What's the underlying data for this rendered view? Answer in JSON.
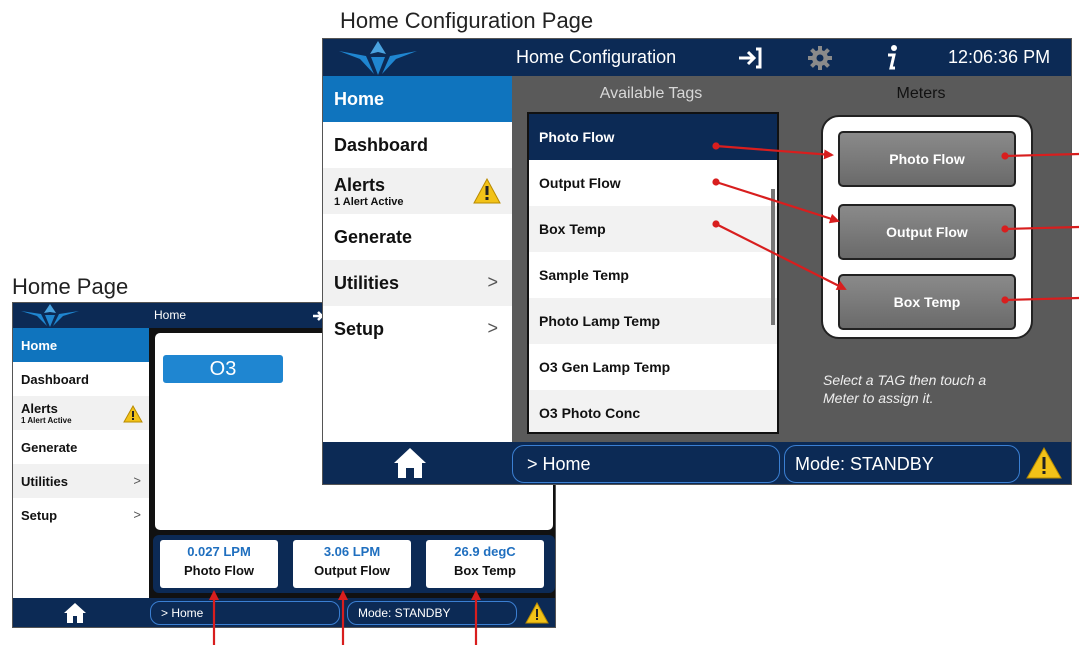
{
  "captions": {
    "home_config": "Home Configuration Page",
    "home": "Home Page"
  },
  "colors": {
    "navy": "#0c2a55",
    "selected_blue": "#0f74be",
    "value_blue": "#1f6fbf",
    "warning_yellow": "#f2c218",
    "arrow_red": "#d81e1e"
  },
  "home_page": {
    "title": "Home",
    "sidebar": [
      {
        "label": "Home",
        "selected": true
      },
      {
        "label": "Dashboard"
      },
      {
        "label": "Alerts",
        "sub": "1 Alert Active",
        "icon": "warning-icon"
      },
      {
        "label": "Generate"
      },
      {
        "label": "Utilities",
        "chevron": ">"
      },
      {
        "label": "Setup",
        "chevron": ">"
      }
    ],
    "o3_label": "O3",
    "meters": [
      {
        "value": "0.027 LPM",
        "label": "Photo Flow"
      },
      {
        "value": "3.06 LPM",
        "label": "Output Flow"
      },
      {
        "value": "26.9 degC",
        "label": "Box Temp"
      }
    ],
    "breadcrumb": "> Home",
    "mode": "Mode: STANDBY"
  },
  "home_config_page": {
    "title": "Home Configuration",
    "time": "12:06:36 PM",
    "sidebar": [
      {
        "label": "Home",
        "selected": true
      },
      {
        "label": "Dashboard"
      },
      {
        "label": "Alerts",
        "sub": "1 Alert Active",
        "icon": "warning-icon"
      },
      {
        "label": "Generate"
      },
      {
        "label": "Utilities",
        "chevron": ">"
      },
      {
        "label": "Setup",
        "chevron": ">"
      }
    ],
    "available_tags_header": "Available Tags",
    "meters_header": "Meters",
    "tags": [
      "Photo Flow",
      "Output Flow",
      "Box Temp",
      "Sample Temp",
      "Photo Lamp Temp",
      "O3 Gen Lamp Temp",
      "O3 Photo Conc"
    ],
    "meters": [
      "Photo Flow",
      "Output Flow",
      "Box Temp"
    ],
    "hint_line1": "Select a TAG then touch a",
    "hint_line2": "Meter to assign it.",
    "breadcrumb": "> Home",
    "mode": "Mode: STANDBY"
  }
}
